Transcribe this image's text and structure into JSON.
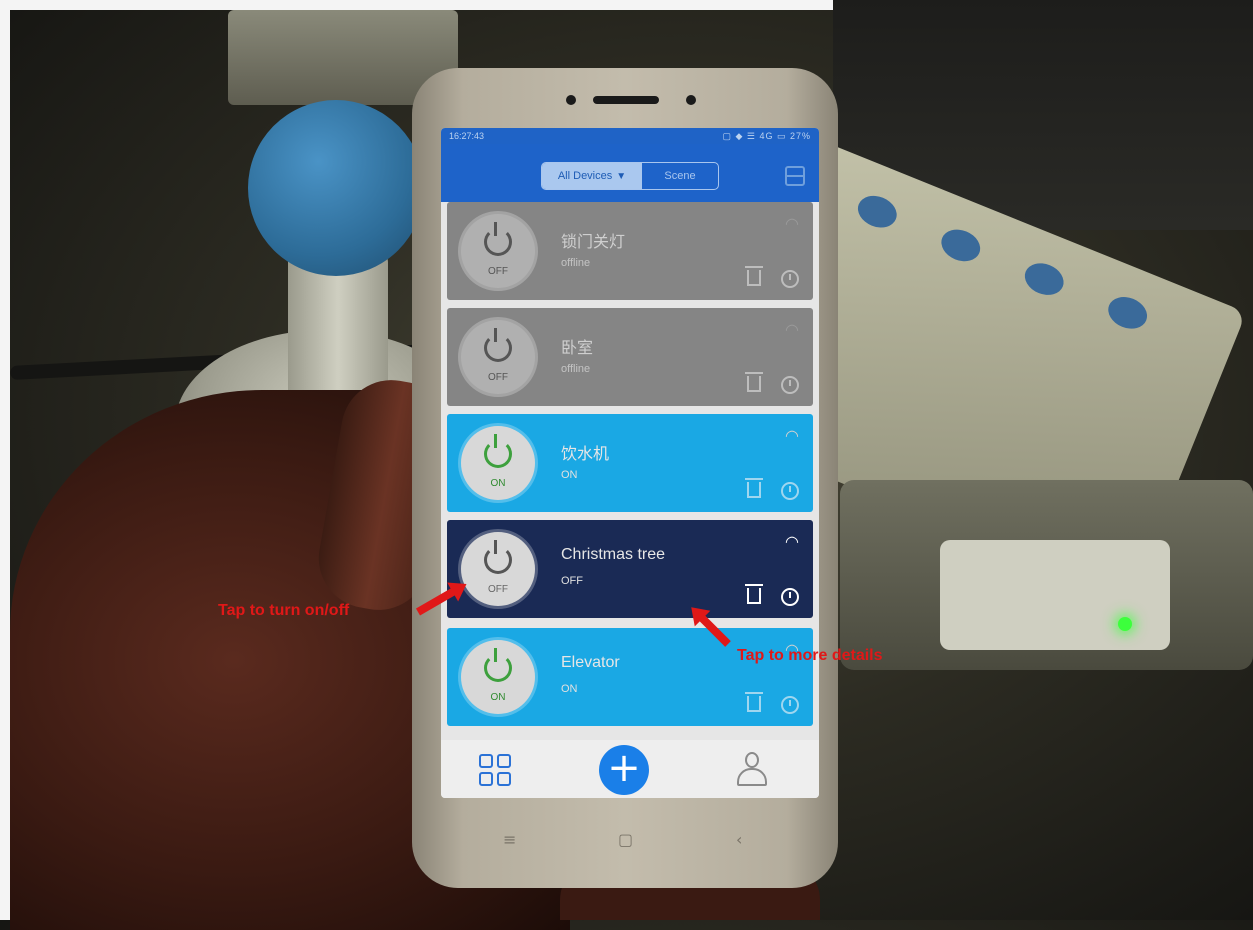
{
  "status_bar": {
    "time": "16:27:43",
    "icons": "▢ ◆ ☰ 4G ▭ 27%"
  },
  "header": {
    "segment_all": "All Devices",
    "segment_scene": "Scene"
  },
  "devices": [
    {
      "name": "锁门关灯",
      "state": "offline",
      "power_label": "OFF"
    },
    {
      "name": "卧室",
      "state": "offline",
      "power_label": "OFF"
    },
    {
      "name": "饮水机",
      "state": "ON",
      "power_label": "ON"
    },
    {
      "name": "Christmas tree",
      "state": "OFF",
      "power_label": "OFF"
    },
    {
      "name": "Elevator",
      "state": "ON",
      "power_label": "ON"
    }
  ],
  "bottom_nav": {
    "add_symbol": "+"
  },
  "annotations": {
    "tap_power": "Tap to turn on/off",
    "tap_details": "Tap to more details"
  },
  "softkeys": {
    "menu": "≡",
    "home": "▢",
    "back": "‹"
  },
  "colors": {
    "header_blue": "#1e63c9",
    "card_offline": "#858585",
    "card_on": "#1aa8e4",
    "card_off": "#1a2a55",
    "annotation_red": "#e01818"
  }
}
